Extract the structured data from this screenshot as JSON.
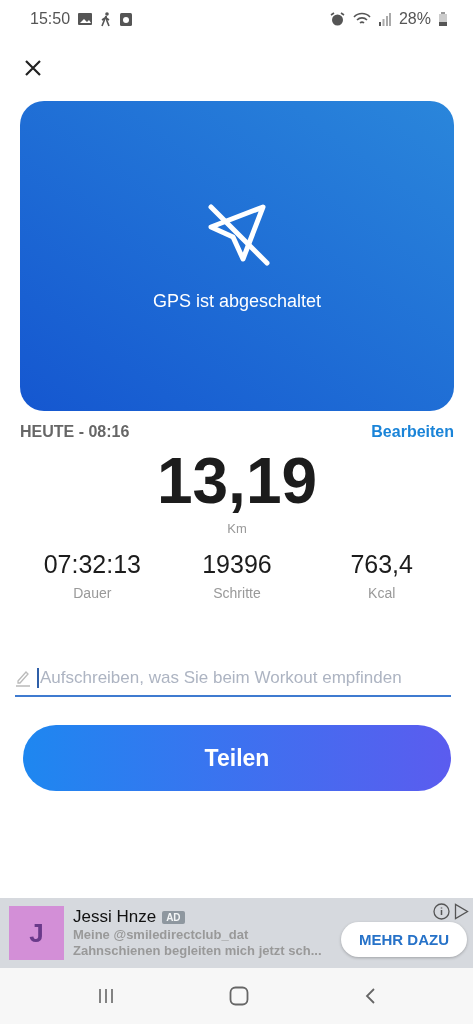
{
  "status_bar": {
    "time": "15:50",
    "battery": "28%"
  },
  "map": {
    "message": "GPS ist abgeschaltet"
  },
  "workout": {
    "date": "HEUTE - 08:16",
    "edit": "Bearbeiten",
    "distance": "13,19",
    "distance_unit": "Km",
    "stats": [
      {
        "value": "07:32:13",
        "label": "Dauer"
      },
      {
        "value": "19396",
        "label": "Schritte"
      },
      {
        "value": "763,4",
        "label": "Kcal"
      }
    ]
  },
  "note_field": {
    "placeholder": "Aufschreiben, was Sie beim Workout empfinden"
  },
  "share_button": "Teilen",
  "ad": {
    "avatar_letter": "J",
    "name": "Jessi Hnze",
    "badge": "AD",
    "text": "Meine @smiledirectclub_dat\nZahnschienen begleiten mich jetzt sch...",
    "button": "MEHR DAZU"
  }
}
